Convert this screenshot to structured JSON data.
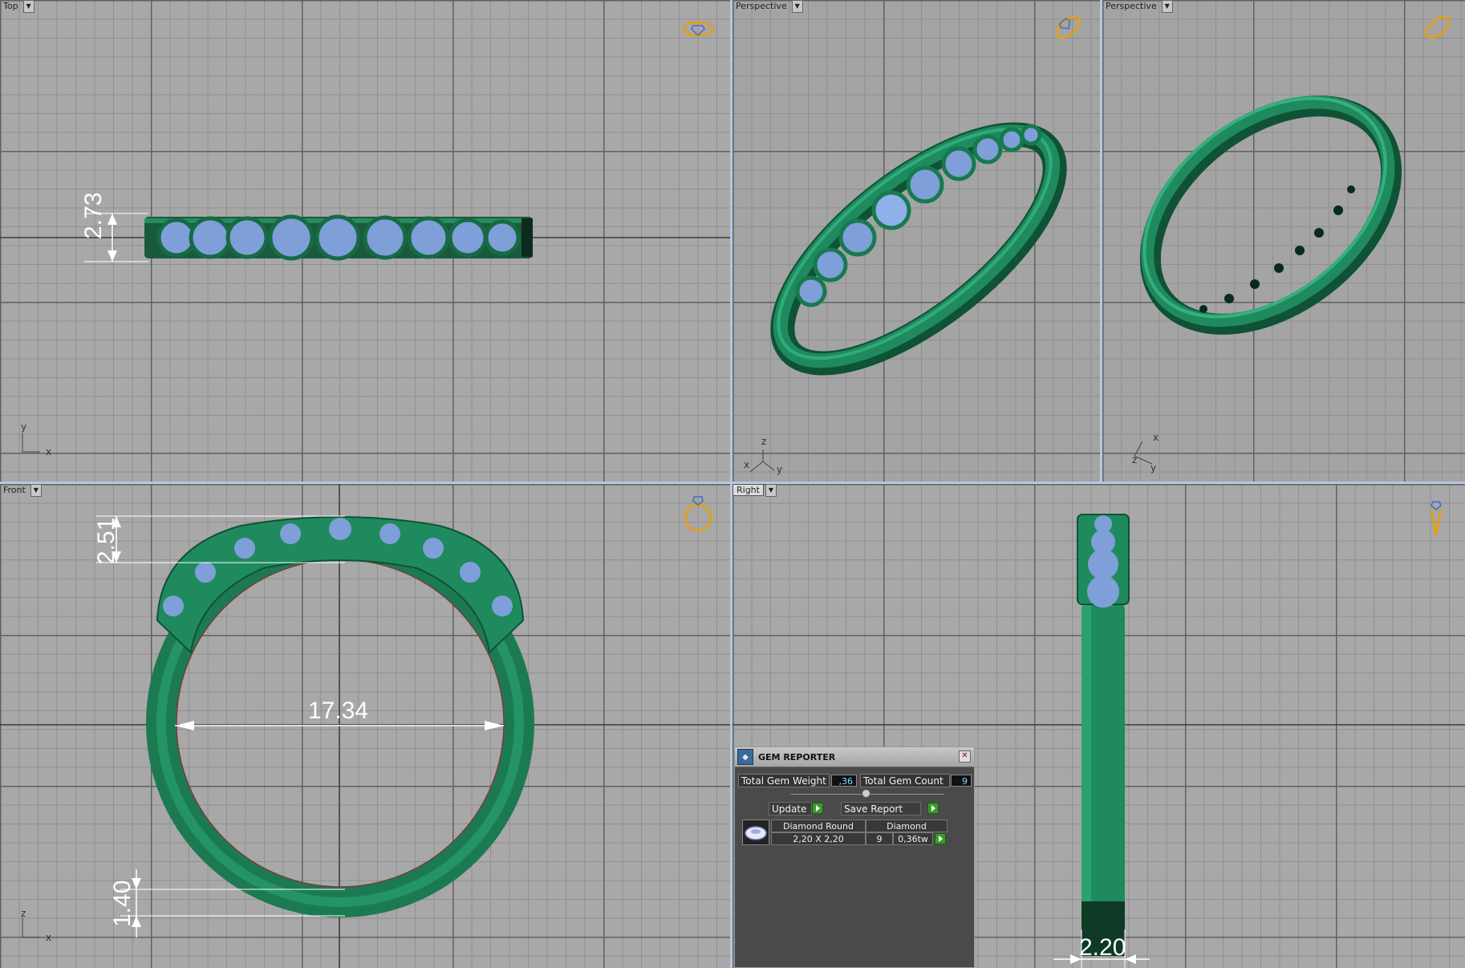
{
  "viewports": {
    "top": {
      "label": "Top",
      "axis_v": "y",
      "axis_h": "x"
    },
    "persp1": {
      "label": "Perspective",
      "axis_a": "z",
      "axis_b": "x",
      "axis_c": "y"
    },
    "persp2": {
      "label": "Perspective",
      "axis_a": "x",
      "axis_b": "z",
      "axis_c": "y"
    },
    "front": {
      "label": "Front",
      "axis_v": "z",
      "axis_h": "x"
    },
    "right": {
      "label": "Right"
    }
  },
  "dimensions": {
    "top_height": "2.73",
    "front_head": "2.51",
    "front_inner_diameter": "17.34",
    "front_shank": "1.40",
    "right_width": "2.20"
  },
  "colors": {
    "metal": "#1f8a5e",
    "gem": "#7f9fd8",
    "grid": "#a8a8a8",
    "dimension": "#ffffff",
    "nav_icon": "#e0a020"
  },
  "icons": [
    "view-cube-icon",
    "gem-icon",
    "play-icon",
    "close-icon"
  ],
  "gem_reporter": {
    "title": "GEM REPORTER",
    "weight_label": "Total Gem Weight",
    "weight_value": ",36",
    "count_label": "Total Gem Count",
    "count_value": "9",
    "update_label": "Update",
    "save_label": "Save Report",
    "gem_name": "Diamond Round",
    "gem_size": "2,20 X 2,20",
    "material": "Diamond",
    "qty": "9",
    "tw": "0,36tw"
  }
}
